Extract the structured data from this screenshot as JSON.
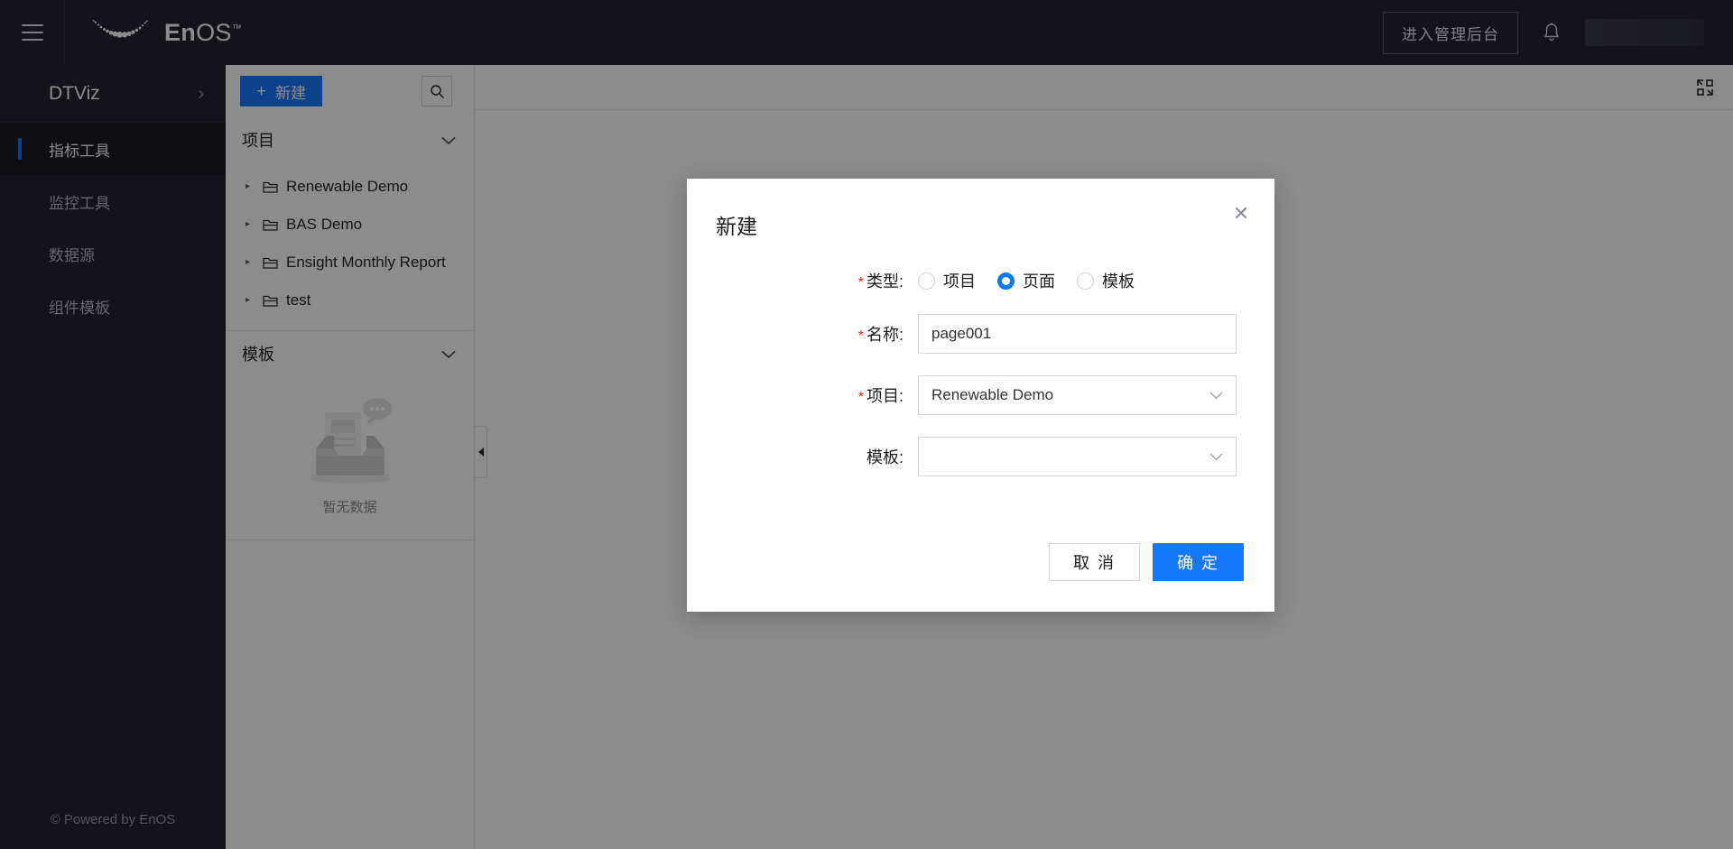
{
  "header": {
    "menu_icon": "hamburger-menu-icon",
    "brand_en": "En",
    "brand_os": "OS",
    "brand_tm": "™",
    "admin_button": "进入管理后台",
    "bell_icon": "notification-bell-icon",
    "user_chip": ""
  },
  "sidebar": {
    "title": "DTViz",
    "expand_icon": "chevron-right-icon",
    "items": [
      {
        "label": "指标工具",
        "active": true
      },
      {
        "label": "监控工具",
        "active": false
      },
      {
        "label": "数据源",
        "active": false
      },
      {
        "label": "组件模板",
        "active": false
      }
    ],
    "footer": "© Powered by EnOS"
  },
  "tree_panel": {
    "new_button": "新建",
    "new_button_icon": "plus-icon",
    "search_icon": "search-icon",
    "sections": [
      {
        "title": "项目",
        "collapse_icon": "chevron-down-icon",
        "items": [
          {
            "label": "Renewable Demo"
          },
          {
            "label": "BAS Demo"
          },
          {
            "label": "Ensight Monthly Report"
          },
          {
            "label": "test"
          }
        ]
      },
      {
        "title": "模板",
        "collapse_icon": "chevron-down-icon",
        "items": [],
        "empty_text": "暂无数据"
      }
    ],
    "collapse_handle_icon": "collapse-left-icon"
  },
  "content": {
    "fullscreen_icon": "fullscreen-expand-icon"
  },
  "modal": {
    "title": "新建",
    "close_icon": "close-icon",
    "fields": {
      "type": {
        "label": "类型:",
        "required": true,
        "options": [
          {
            "label": "项目",
            "checked": false
          },
          {
            "label": "页面",
            "checked": true
          },
          {
            "label": "模板",
            "checked": false
          }
        ]
      },
      "name": {
        "label": "名称:",
        "required": true,
        "value": "page001",
        "placeholder": ""
      },
      "project": {
        "label": "项目:",
        "required": true,
        "value": "Renewable Demo",
        "chevron_icon": "chevron-down-icon"
      },
      "template": {
        "label": "模板:",
        "required": false,
        "value": "",
        "chevron_icon": "chevron-down-icon"
      }
    },
    "cancel_button": "取 消",
    "ok_button": "确 定"
  },
  "colors": {
    "header_bg": "#23232e",
    "accent_blue": "#1677ff",
    "radio_blue": "#0d7bf7",
    "required_red": "#f5222d"
  }
}
